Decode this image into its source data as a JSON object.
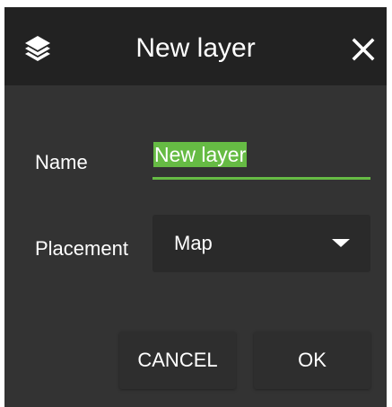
{
  "dialog": {
    "title": "New layer",
    "icons": {
      "title_icon": "layers-icon",
      "close_icon": "close-icon",
      "select_icon": "chevron-down-icon"
    },
    "name_label": "Name",
    "name_value": "New layer",
    "placement_label": "Placement",
    "placement_value": "Map",
    "cancel_label": "CANCEL",
    "ok_label": "OK"
  },
  "colors": {
    "title_bar": "#222222",
    "body": "#333333",
    "accent": "#66bb44",
    "text": "#ffffff"
  }
}
